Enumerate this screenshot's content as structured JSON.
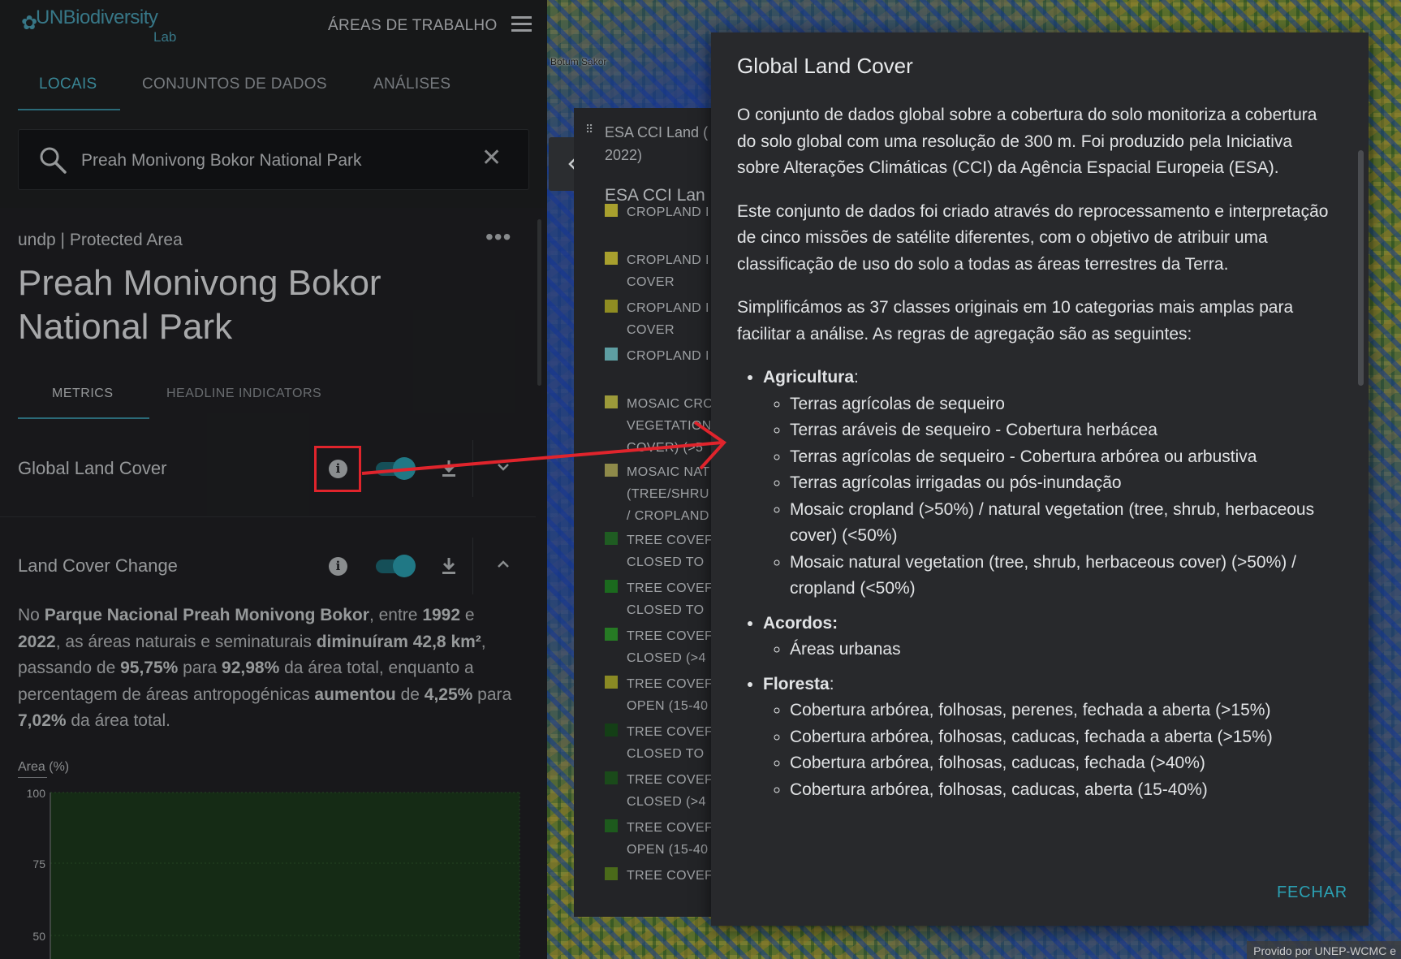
{
  "app": {
    "logo_text": "UNBiodiversity",
    "logo_sub": "Lab",
    "workspaces_label": "ÁREAS DE TRABALHO"
  },
  "nav": {
    "tabs": [
      {
        "label": "LOCAIS",
        "active": true
      },
      {
        "label": "CONJUNTOS DE DADOS",
        "active": false
      },
      {
        "label": "ANÁLISES",
        "active": false
      }
    ]
  },
  "search": {
    "value": "Preah Monivong Bokor National Park",
    "clear_icon": "close-icon"
  },
  "location": {
    "subtitle": "undp | Protected Area",
    "title": "Preah Monivong Bokor National Park",
    "subtabs": [
      {
        "label": "METRICS",
        "active": true
      },
      {
        "label": "HEADLINE INDICATORS",
        "active": false
      }
    ]
  },
  "layers": [
    {
      "label": "Global Land Cover",
      "enabled": true,
      "expanded": false
    },
    {
      "label": "Land Cover Change",
      "enabled": true,
      "expanded": true
    }
  ],
  "summary_parts": [
    {
      "t": "No ",
      "b": false
    },
    {
      "t": "Parque Nacional Preah Monivong Bokor",
      "b": true
    },
    {
      "t": ", entre ",
      "b": false
    },
    {
      "t": "1992",
      "b": true
    },
    {
      "t": " e ",
      "b": false
    },
    {
      "t": "2022",
      "b": true
    },
    {
      "t": ", as áreas naturais e seminaturais ",
      "b": false
    },
    {
      "t": "diminuíram 42,8 km²",
      "b": true
    },
    {
      "t": ", passando de ",
      "b": false
    },
    {
      "t": "95,75%",
      "b": true
    },
    {
      "t": " para ",
      "b": false
    },
    {
      "t": "92,98%",
      "b": true
    },
    {
      "t": " da área total, enquanto a percentagem de áreas antropogénicas ",
      "b": false
    },
    {
      "t": "aumentou",
      "b": true
    },
    {
      "t": " de ",
      "b": false
    },
    {
      "t": "4,25%",
      "b": true
    },
    {
      "t": " para ",
      "b": false
    },
    {
      "t": "7,02%",
      "b": true
    },
    {
      "t": " da área total.",
      "b": false
    }
  ],
  "chart": {
    "ylabel": "Area (%)",
    "ticks": [
      "100",
      "75",
      "50"
    ]
  },
  "legend": {
    "title": "ESA CCI Land (\n2022)",
    "title2": "ESA CCI Lan",
    "items": [
      {
        "text": "CROPLAND I",
        "color": "#a8a02e"
      },
      {
        "text": "CROPLAND I\nCOVER",
        "color": "#a8a02e"
      },
      {
        "text": "CROPLAND I\nCOVER",
        "color": "#8f8c22"
      },
      {
        "text": "CROPLAND I",
        "color": "#5e9ea2"
      },
      {
        "text": "MOSAIC CRO\nVEGETATION\nCOVER) (>5",
        "color": "#9c9a3a"
      },
      {
        "text": "MOSAIC NAT\n(TREE/SHRU\n/ CROPLAND",
        "color": "#8e8a4a"
      },
      {
        "text": "TREE COVEF\nCLOSED TO",
        "color": "#1f5c22"
      },
      {
        "text": "TREE COVEF\nCLOSED TO",
        "color": "#1b6a1e"
      },
      {
        "text": "TREE COVEF\nCLOSED (>4",
        "color": "#267a24"
      },
      {
        "text": "TREE COVEF\nOPEN (15-40",
        "color": "#8a8a24"
      },
      {
        "text": "TREE COVEF\nCLOSED TO",
        "color": "#143f16"
      },
      {
        "text": "TREE COVEF\nCLOSED (>4",
        "color": "#1a4a1a"
      },
      {
        "text": "TREE COVEF\nOPEN (15-40",
        "color": "#1d5a1d"
      },
      {
        "text": "TREE COVEF",
        "color": "#4a6a1a"
      }
    ]
  },
  "dialog": {
    "title": "Global Land Cover",
    "paragraphs": [
      "O conjunto de dados global sobre a cobertura do solo monitoriza a cobertura do solo global com uma resolução de 300 m. Foi produzido pela Iniciativa sobre Alterações Climáticas (CCI) da Agência Espacial Europeia (ESA).",
      "Este conjunto de dados foi criado através do reprocessamento e interpretação de cinco missões de satélite diferentes, com o objetivo de atribuir uma classificação de uso do solo a todas as áreas terrestres da Terra.",
      "Simplificámos as 37 classes originais em 10 categorias mais amplas para facilitar a análise. As regras de agregação são as seguintes:"
    ],
    "categories": [
      {
        "name": "Agricultura",
        "suffix": ":",
        "items": [
          "Terras agrícolas de sequeiro",
          "Terras aráveis de sequeiro - Cobertura herbácea",
          "Terras agrícolas de sequeiro - Cobertura arbórea ou arbustiva",
          "Terras agrícolas irrigadas ou pós-inundação",
          "Mosaic cropland (>50%) / natural vegetation (tree, shrub, herbaceous cover) (<50%)",
          "Mosaic natural vegetation (tree, shrub, herbaceous cover) (>50%) / cropland (<50%)"
        ]
      },
      {
        "name": "Acordos:",
        "suffix": "",
        "items": [
          "Áreas urbanas"
        ]
      },
      {
        "name": "Floresta",
        "suffix": ":",
        "items": [
          "Cobertura arbórea, folhosas, perenes, fechada a aberta (>15%)",
          "Cobertura arbórea, folhosas, caducas, fechada a aberta (>15%)",
          "Cobertura arbórea, folhosas, caducas, fechada (>40%)",
          "Cobertura arbórea, folhosas, caducas, aberta (15-40%)"
        ]
      }
    ],
    "close_label": "FECHAR"
  },
  "map": {
    "place_label": "Botum Sakor",
    "attribution": "Provido por UNEP-WCMC e"
  },
  "colors": {
    "accent": "#2ba0b2",
    "highlight": "#e0242c"
  }
}
